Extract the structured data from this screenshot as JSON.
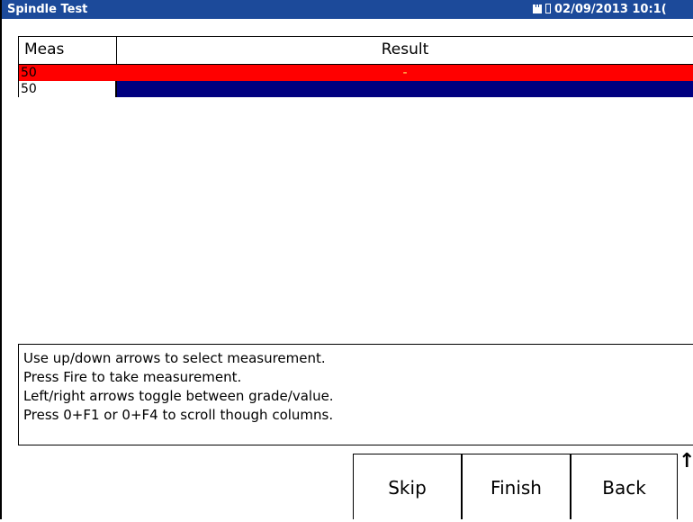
{
  "title": "Spindle Test",
  "status": {
    "icons": [
      "sd-card-icon",
      "battery-icon"
    ],
    "datetime": "02/09/2013 10:1("
  },
  "table": {
    "headers": [
      "Meas",
      "Result"
    ],
    "rows": [
      {
        "meas": "50",
        "result": "-",
        "state": "red"
      },
      {
        "meas": "50",
        "result": "",
        "state": "selected"
      }
    ]
  },
  "help_lines": [
    "Use up/down arrows to select measurement.",
    "Press Fire to take measurement.",
    "Left/right arrows toggle between grade/value.",
    "Press 0+F1 or 0+F4 to scroll though columns."
  ],
  "buttons": {
    "skip": "Skip",
    "finish": "Finish",
    "back": "Back"
  },
  "scroll_arrow": "↑",
  "colors": {
    "titlebar": "#1c4a9a",
    "row_red": "#ff0000",
    "row_selected": "#000080"
  }
}
